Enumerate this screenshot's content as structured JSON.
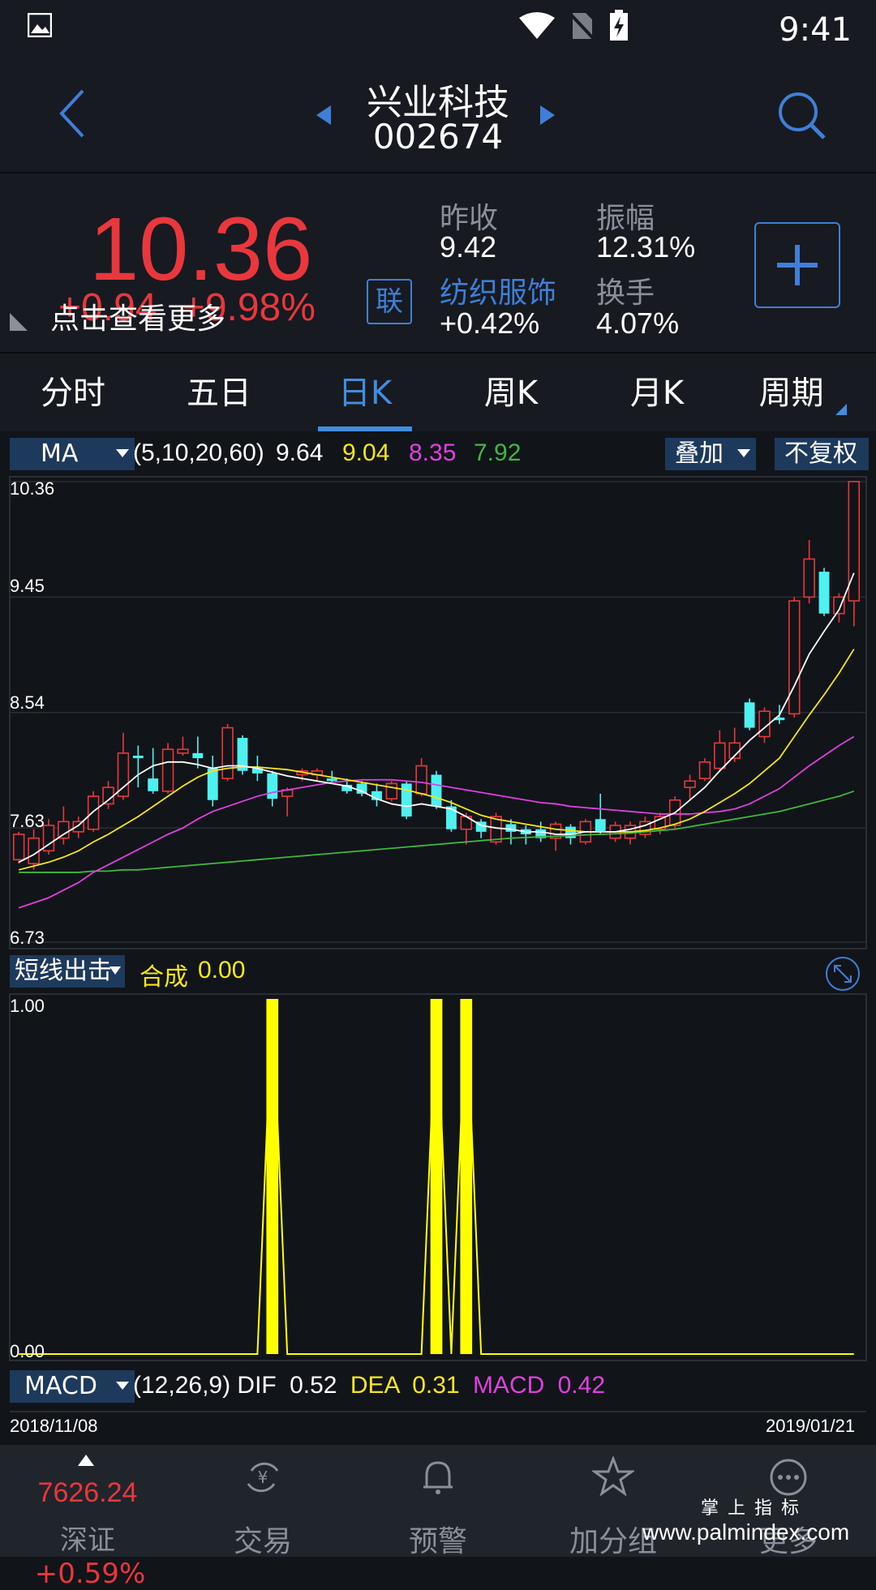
{
  "status_bar": {
    "time": "9:41"
  },
  "header": {
    "stock_name": "兴业科技",
    "stock_code": "002674"
  },
  "quote": {
    "price": "10.36",
    "change": "+0.94",
    "change_pct": "+9.98%",
    "more_tip": "点击查看更多",
    "lian_badge": "联",
    "prev_close_label": "昨收",
    "prev_close": "9.42",
    "amplitude_label": "振幅",
    "amplitude": "12.31%",
    "sector_label": "纺织服饰",
    "sector_change": "+0.42%",
    "turnover_label": "换手",
    "turnover": "4.07%"
  },
  "tabs": [
    "分时",
    "五日",
    "日K",
    "周K",
    "月K",
    "周期"
  ],
  "active_tab": 2,
  "ma_bar": {
    "selector": "MA",
    "params": "(5,10,20,60)",
    "ma5": "9.64",
    "ma10": "9.04",
    "ma20": "8.35",
    "ma60": "7.92",
    "overlay_label": "叠加",
    "adjust_label": "不复权"
  },
  "indicator_bar": {
    "selector": "短线出击",
    "name": "合成",
    "value": "0.00"
  },
  "macd_bar": {
    "selector": "MACD",
    "params": "(12,26,9)",
    "dif_label": "DIF",
    "dif": "0.52",
    "dea_label": "DEA",
    "dea": "0.31",
    "macd_label": "MACD",
    "macd": "0.42"
  },
  "dates": {
    "start": "2018/11/08",
    "end": "2019/01/21"
  },
  "colors": {
    "up": "#e8383d",
    "down": "#4ff0f0",
    "ma5": "#ffffff",
    "ma10": "#f5e61a",
    "ma20": "#e040e0",
    "ma60": "#3fb83f",
    "accent": "#3f8ee0",
    "signal": "#ffff00"
  },
  "chart_data": [
    {
      "type": "candlestick",
      "y_ticks": [
        "10.36",
        "9.45",
        "8.54",
        "7.63",
        "6.73"
      ],
      "ylim": [
        6.73,
        10.36
      ],
      "candles": [
        {
          "o": 7.38,
          "c": 7.58,
          "h": 7.6,
          "l": 7.35
        },
        {
          "o": 7.35,
          "c": 7.55,
          "h": 7.62,
          "l": 7.3
        },
        {
          "o": 7.45,
          "c": 7.65,
          "h": 7.7,
          "l": 7.42
        },
        {
          "o": 7.55,
          "c": 7.68,
          "h": 7.8,
          "l": 7.5
        },
        {
          "o": 7.6,
          "c": 7.68,
          "h": 7.72,
          "l": 7.55
        },
        {
          "o": 7.62,
          "c": 7.88,
          "h": 7.92,
          "l": 7.6
        },
        {
          "o": 7.82,
          "c": 7.95,
          "h": 8.0,
          "l": 7.78
        },
        {
          "o": 7.88,
          "c": 8.22,
          "h": 8.38,
          "l": 7.85
        },
        {
          "o": 8.2,
          "c": 8.18,
          "h": 8.28,
          "l": 7.95
        },
        {
          "o": 8.02,
          "c": 7.92,
          "h": 8.26,
          "l": 7.9
        },
        {
          "o": 7.92,
          "c": 8.25,
          "h": 8.3,
          "l": 7.9
        },
        {
          "o": 8.22,
          "c": 8.25,
          "h": 8.35,
          "l": 8.2
        },
        {
          "o": 8.22,
          "c": 8.18,
          "h": 8.35,
          "l": 8.1
        },
        {
          "o": 8.1,
          "c": 7.85,
          "h": 8.2,
          "l": 7.8
        },
        {
          "o": 8.02,
          "c": 8.42,
          "h": 8.45,
          "l": 8.0
        },
        {
          "o": 8.34,
          "c": 8.08,
          "h": 8.36,
          "l": 8.05
        },
        {
          "o": 8.1,
          "c": 8.06,
          "h": 8.2,
          "l": 8.0
        },
        {
          "o": 8.06,
          "c": 7.86,
          "h": 8.08,
          "l": 7.8
        },
        {
          "o": 7.88,
          "c": 7.93,
          "h": 7.95,
          "l": 7.72
        },
        {
          "o": 8.05,
          "c": 8.08,
          "h": 8.1,
          "l": 8.0
        },
        {
          "o": 8.05,
          "c": 8.08,
          "h": 8.1,
          "l": 8.0
        },
        {
          "o": 8.02,
          "c": 8.0,
          "h": 8.08,
          "l": 7.98
        },
        {
          "o": 7.97,
          "c": 7.92,
          "h": 8.02,
          "l": 7.9
        },
        {
          "o": 7.98,
          "c": 7.9,
          "h": 8.0,
          "l": 7.88
        },
        {
          "o": 7.92,
          "c": 7.85,
          "h": 7.98,
          "l": 7.8
        },
        {
          "o": 7.86,
          "c": 7.98,
          "h": 8.0,
          "l": 7.84
        },
        {
          "o": 7.98,
          "c": 7.72,
          "h": 8.0,
          "l": 7.7
        },
        {
          "o": 7.9,
          "c": 8.12,
          "h": 8.18,
          "l": 7.88
        },
        {
          "o": 8.05,
          "c": 7.8,
          "h": 8.08,
          "l": 7.78
        },
        {
          "o": 7.8,
          "c": 7.62,
          "h": 7.85,
          "l": 7.6
        },
        {
          "o": 7.62,
          "c": 7.72,
          "h": 7.75,
          "l": 7.5
        },
        {
          "o": 7.68,
          "c": 7.6,
          "h": 7.7,
          "l": 7.55
        },
        {
          "o": 7.52,
          "c": 7.72,
          "h": 7.75,
          "l": 7.5
        },
        {
          "o": 7.66,
          "c": 7.6,
          "h": 7.7,
          "l": 7.5
        },
        {
          "o": 7.62,
          "c": 7.58,
          "h": 7.65,
          "l": 7.5
        },
        {
          "o": 7.62,
          "c": 7.55,
          "h": 7.68,
          "l": 7.52
        },
        {
          "o": 7.55,
          "c": 7.66,
          "h": 7.68,
          "l": 7.45
        },
        {
          "o": 7.64,
          "c": 7.55,
          "h": 7.66,
          "l": 7.5
        },
        {
          "o": 7.52,
          "c": 7.68,
          "h": 7.7,
          "l": 7.5
        },
        {
          "o": 7.7,
          "c": 7.6,
          "h": 7.9,
          "l": 7.58
        },
        {
          "o": 7.55,
          "c": 7.65,
          "h": 7.68,
          "l": 7.52
        },
        {
          "o": 7.55,
          "c": 7.65,
          "h": 7.68,
          "l": 7.5
        },
        {
          "o": 7.58,
          "c": 7.68,
          "h": 7.72,
          "l": 7.55
        },
        {
          "o": 7.62,
          "c": 7.72,
          "h": 7.75,
          "l": 7.58
        },
        {
          "o": 7.65,
          "c": 7.85,
          "h": 7.88,
          "l": 7.62
        },
        {
          "o": 7.95,
          "c": 8.0,
          "h": 8.05,
          "l": 7.85
        },
        {
          "o": 8.02,
          "c": 8.15,
          "h": 8.18,
          "l": 8.0
        },
        {
          "o": 8.1,
          "c": 8.3,
          "h": 8.4,
          "l": 8.08
        },
        {
          "o": 8.18,
          "c": 8.3,
          "h": 8.42,
          "l": 8.15
        },
        {
          "o": 8.62,
          "c": 8.42,
          "h": 8.65,
          "l": 8.4
        },
        {
          "o": 8.35,
          "c": 8.55,
          "h": 8.58,
          "l": 8.3
        },
        {
          "o": 8.5,
          "c": 8.48,
          "h": 8.6,
          "l": 8.45
        },
        {
          "o": 8.53,
          "c": 9.42,
          "h": 9.45,
          "l": 8.5
        },
        {
          "o": 9.45,
          "c": 9.75,
          "h": 9.9,
          "l": 9.4
        },
        {
          "o": 9.65,
          "c": 9.32,
          "h": 9.68,
          "l": 9.3
        },
        {
          "o": 9.32,
          "c": 9.45,
          "h": 9.48,
          "l": 9.25
        },
        {
          "o": 9.42,
          "c": 10.36,
          "h": 10.36,
          "l": 9.22
        }
      ],
      "ma5": [
        7.36,
        7.42,
        7.5,
        7.58,
        7.65,
        7.76,
        7.85,
        7.95,
        8.05,
        8.12,
        8.15,
        8.15,
        8.13,
        8.1,
        8.12,
        8.12,
        8.1,
        8.07,
        8.04,
        8.02,
        8.0,
        7.98,
        7.96,
        7.92,
        7.86,
        7.82,
        7.8,
        7.82,
        7.8,
        7.78,
        7.72,
        7.65,
        7.63,
        7.62,
        7.6,
        7.6,
        7.58,
        7.58,
        7.6,
        7.6,
        7.6,
        7.62,
        7.65,
        7.7,
        7.75,
        7.85,
        7.95,
        8.08,
        8.2,
        8.32,
        8.42,
        8.52,
        8.75,
        9.0,
        9.18,
        9.35,
        9.64
      ],
      "ma10": [
        7.3,
        7.33,
        7.36,
        7.4,
        7.45,
        7.52,
        7.58,
        7.65,
        7.72,
        7.8,
        7.88,
        7.96,
        8.03,
        8.08,
        8.1,
        8.11,
        8.11,
        8.1,
        8.09,
        8.07,
        8.05,
        8.03,
        8.01,
        7.99,
        7.97,
        7.95,
        7.93,
        7.9,
        7.87,
        7.83,
        7.78,
        7.73,
        7.7,
        7.68,
        7.66,
        7.64,
        7.62,
        7.61,
        7.6,
        7.6,
        7.6,
        7.6,
        7.61,
        7.63,
        7.66,
        7.7,
        7.76,
        7.83,
        7.9,
        7.98,
        8.08,
        8.18,
        8.35,
        8.52,
        8.68,
        8.85,
        9.04
      ],
      "ma20": [
        7.0,
        7.04,
        7.08,
        7.14,
        7.2,
        7.28,
        7.34,
        7.4,
        7.46,
        7.52,
        7.58,
        7.63,
        7.7,
        7.76,
        7.8,
        7.84,
        7.88,
        7.91,
        7.93,
        7.95,
        7.97,
        7.99,
        8.0,
        8.01,
        8.01,
        8.01,
        8.0,
        7.99,
        7.97,
        7.95,
        7.93,
        7.91,
        7.89,
        7.87,
        7.85,
        7.83,
        7.82,
        7.8,
        7.79,
        7.78,
        7.77,
        7.76,
        7.75,
        7.74,
        7.74,
        7.74,
        7.75,
        7.76,
        7.78,
        7.82,
        7.88,
        7.94,
        8.03,
        8.12,
        8.2,
        8.28,
        8.35
      ],
      "ma60": [
        7.28,
        7.28,
        7.28,
        7.28,
        7.28,
        7.29,
        7.29,
        7.3,
        7.3,
        7.31,
        7.32,
        7.33,
        7.34,
        7.35,
        7.36,
        7.37,
        7.38,
        7.39,
        7.4,
        7.41,
        7.42,
        7.43,
        7.44,
        7.45,
        7.46,
        7.47,
        7.48,
        7.49,
        7.5,
        7.51,
        7.52,
        7.53,
        7.54,
        7.55,
        7.555,
        7.56,
        7.565,
        7.57,
        7.575,
        7.58,
        7.585,
        7.59,
        7.6,
        7.61,
        7.62,
        7.64,
        7.66,
        7.68,
        7.7,
        7.72,
        7.74,
        7.76,
        7.79,
        7.82,
        7.85,
        7.88,
        7.92
      ]
    },
    {
      "type": "bar",
      "title": "短线出击",
      "y_ticks": [
        "1.00",
        "0.00"
      ],
      "ylim": [
        0,
        1
      ],
      "signal_indices": [
        17,
        28,
        30
      ],
      "count": 57
    }
  ],
  "bottom_nav": {
    "index_value": "7626.24",
    "index_name": "深证",
    "index_change": "+0.59%",
    "items": [
      "交易",
      "预警",
      "加分组",
      "更多"
    ]
  },
  "watermark": {
    "cn": "掌 上 指 标",
    "url": "www.palmindex.com"
  }
}
